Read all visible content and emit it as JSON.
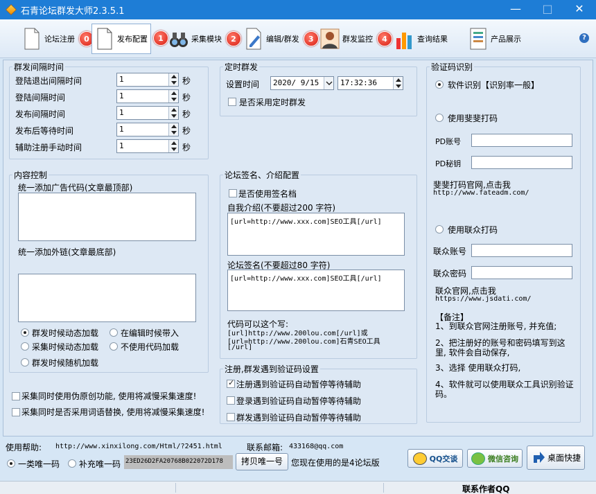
{
  "window": {
    "title": "石青论坛群发大师2.3.5.1",
    "minimize": "—",
    "maximize": "□",
    "close": "✕"
  },
  "toolbar": {
    "items": [
      {
        "label": "论坛注册",
        "badge": "0"
      },
      {
        "label": "发布配置",
        "badge": "1"
      },
      {
        "label": "采集模块",
        "badge": "2"
      },
      {
        "label": "编辑/群发",
        "badge": "3"
      },
      {
        "label": "群发监控",
        "badge": "4"
      },
      {
        "label": "查询结果"
      },
      {
        "label": "产品展示"
      }
    ],
    "help": "?"
  },
  "interval": {
    "title": "群发间隔时间",
    "unit": "秒",
    "rows": [
      {
        "label": "登陆退出间隔时间",
        "value": "1"
      },
      {
        "label": "登陆间隔时间",
        "value": "1"
      },
      {
        "label": "发布间隔时间",
        "value": "1"
      },
      {
        "label": "发布后等待时间",
        "value": "1"
      },
      {
        "label": "辅助注册手动时间",
        "value": "1"
      }
    ]
  },
  "schedule": {
    "title": "定时群发",
    "set_time_label": "设置时间",
    "date": "2020/ 9/15",
    "time": "17:32:36",
    "use_schedule": "是否采用定时群发"
  },
  "content": {
    "title": "内容控制",
    "ad_top_label": "统一添加广告代码(文章最顶部)",
    "ad_top_value": "",
    "link_bottom_label": "统一添加外链(文章最底部)",
    "link_bottom_value": "",
    "options": [
      "群发时候动态加载",
      "在编辑时候带入",
      "采集时候动态加载",
      "不使用代码加载",
      "群发时候随机加载"
    ]
  },
  "signature": {
    "title": "论坛签名、介绍配置",
    "use_sig": "是否使用签名档",
    "intro_label": "自我介绍(不要超过200 字符)",
    "intro_value": "[url=http://www.xxx.com]SEO工具[/url]",
    "sig_label": "论坛签名(不要超过80 字符)",
    "sig_value": "[url=http://www.xxx.com]SEO工具[/url]",
    "hint_title": "代码可以这个写:",
    "hint_line1": "[url]http://www.200lou.com[/url]或",
    "hint_line2": "[url=http://www.200lou.com]石青SEO工具",
    "hint_line3": "[/url]"
  },
  "captcha_settings": {
    "title": "注册,群发遇到验证码设置",
    "items": [
      {
        "label": "注册遇到验证码自动暂停等待辅助",
        "checked": true
      },
      {
        "label": "登录遇到验证码自动暂停等待辅助",
        "checked": false
      },
      {
        "label": "群发遇到验证码自动暂停等待辅助",
        "checked": false
      }
    ]
  },
  "misc_options": [
    "采集同时使用伪原创功能, 使用将减慢采集速度!",
    "采集同时是否采用词语替换, 使用将减慢采集速度!"
  ],
  "captcha": {
    "title": "验证码识别",
    "soft": "软件识别【识别率一般】",
    "fateadm": "使用斐斐打码",
    "pd_account": "PD账号",
    "pd_key": "PD秘钥",
    "fateadm_site": "斐斐打码官网,点击我",
    "fateadm_url": "http://www.fateadm.com/",
    "lianzhong": "使用联众打码",
    "lz_account": "联众账号",
    "lz_password": "联众密码",
    "lz_site": "联众官网,点击我",
    "lz_url": "https://www.jsdati.com/",
    "notes_title": "【备注】",
    "note1": "1、到联众官网注册账号, 并充值;",
    "note2": "2、把注册好的账号和密码填写到这里, 软件会自动保存,",
    "note3": "3、选择 使用联众打码,",
    "note4": "4、软件就可以使用联众工具识别验证码。"
  },
  "footer": {
    "help_label": "使用帮助:",
    "help_url": "http://www.xinxilong.com/Html/?2451.html",
    "email_label": "联系邮箱:",
    "email": "433168@qq.com",
    "code_option1": "一类唯一码",
    "code_option2": "补充唯一码",
    "code_value": "23ED26D2FA20768B022072D178",
    "copy_button": "拷贝唯一号",
    "version_text": "您现在使用的是4论坛版",
    "qq_button": "QQ交谈",
    "wechat_button": "微信咨询",
    "desktop_button": "桌面快捷"
  },
  "status": {
    "contact": "联系作者QQ"
  },
  "colors": {
    "titlebar": "#1e7dd6",
    "background": "#d6e6f5",
    "badge": "#d81b10"
  }
}
